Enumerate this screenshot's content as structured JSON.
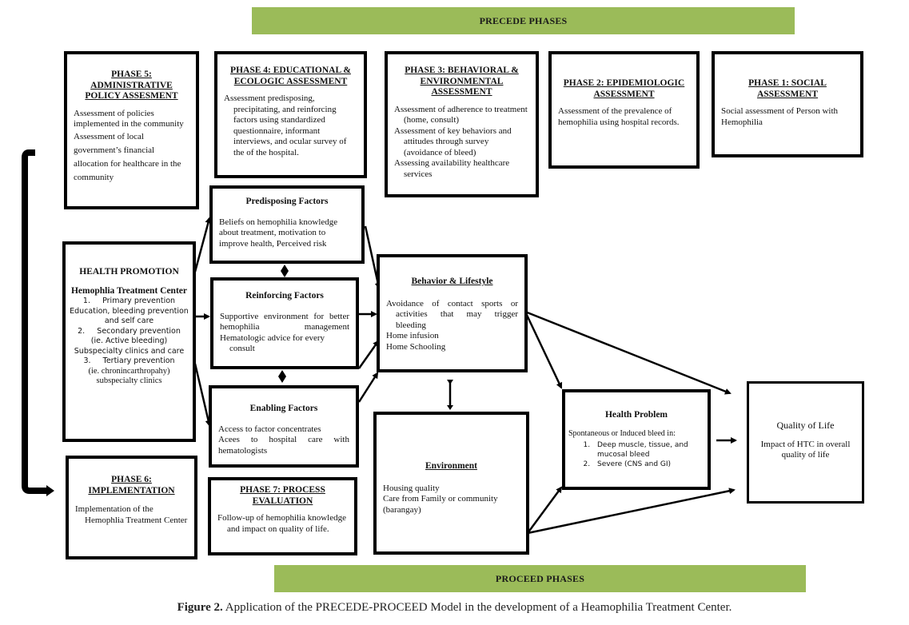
{
  "bands": {
    "precede": "PRECEDE PHASES",
    "proceed": "PROCEED PHASES"
  },
  "phase5": {
    "title": "PHASE 5: ADMINISTRATIVE POLICY ASSESMENT",
    "lines": [
      "Assessment of policies implemented in the community",
      "Assessment of local government’s financial allocation for healthcare in the community"
    ]
  },
  "phase4": {
    "title": "PHASE 4: EDUCATIONAL & ECOLOGIC ASSESSMENT",
    "lines": [
      "Assessment predisposing, precipitating, and reinforcing factors using standardized questionnaire, informant interviews, and ocular survey of the of the hospital."
    ]
  },
  "phase3": {
    "title": "PHASE 3: BEHAVIORAL & ENVIRONMENTAL ASSESSMENT",
    "lines": [
      "Assessment of adherence to treatment (home, consult)",
      "Assessment of key behaviors and attitudes through survey (avoidance of bleed)",
      "Assessing availability healthcare services"
    ]
  },
  "phase2": {
    "title": "PHASE 2: EPIDEMIOLOGIC ASSESSMENT",
    "lines": [
      "Assessment of the prevalence of hemophilia using hospital records."
    ]
  },
  "phase1": {
    "title": "PHASE 1: SOCIAL ASSESSMENT",
    "lines": [
      "Social assessment of Person with Hemophilia"
    ]
  },
  "health_promotion": {
    "title": "HEALTH PROMOTION",
    "subtitle": "Hemophlia Treatment Center",
    "items": [
      {
        "num": "1.",
        "label": "Primary prevention",
        "detail": "Education, bleeding prevention and self care"
      },
      {
        "num": "2.",
        "label": "Secondary prevention",
        "detail": "(ie. Active bleeding)",
        "detail2": "Subspecialty clinics and care"
      },
      {
        "num": "3.",
        "label": "Tertiary prevention",
        "detail": "(ie. chronincarthropahy)",
        "detail2": "subspecialty clinics"
      }
    ]
  },
  "predisposing": {
    "title": "Predisposing Factors",
    "lines": [
      "Beliefs on hemophilia knowledge about treatment, motivation to improve health, Perceived risk"
    ]
  },
  "reinforcing": {
    "title": "Reinforcing Factors",
    "lines": [
      "Supportive environment for better hemophilia management",
      "Hematologic advice for every consult"
    ]
  },
  "enabling": {
    "title": "Enabling Factors",
    "lines": [
      "Access to factor concentrates",
      "Acees to hospital care with hematologists"
    ]
  },
  "behavior": {
    "title": "Behavior & Lifestyle",
    "lines": [
      "Avoidance of contact sports or activities that may trigger bleeding",
      "Home infusion",
      "Home Schooling"
    ]
  },
  "environment": {
    "title": "Environment",
    "lines": [
      "Housing quality",
      "Care from Family or community (barangay)"
    ]
  },
  "health_problem": {
    "title": "Health Problem",
    "intro": "Spontaneous or Induced bleed in:",
    "items": [
      "Deep muscle, tissue, and mucosal bleed",
      "Severe (CNS and GI)"
    ]
  },
  "quality_of_life": {
    "title": "Quality of Life",
    "lines": [
      "Impact of HTC in overall quality of life"
    ]
  },
  "phase6": {
    "title": "PHASE 6: IMPLEMENTATION",
    "lines": [
      "Implementation of the Hemophlia Treatment Center"
    ]
  },
  "phase7": {
    "title": "PHASE 7: PROCESS EVALUATION",
    "lines": [
      "Follow-up of hemophilia knowledge and impact on quality of life."
    ]
  },
  "caption": {
    "label": "Figure 2.",
    "text": " Application of the PRECEDE-PROCEED Model in the development of a Heamophilia Treatment Center."
  },
  "colors": {
    "band_green": "#9bbb59",
    "border": "#000000"
  }
}
